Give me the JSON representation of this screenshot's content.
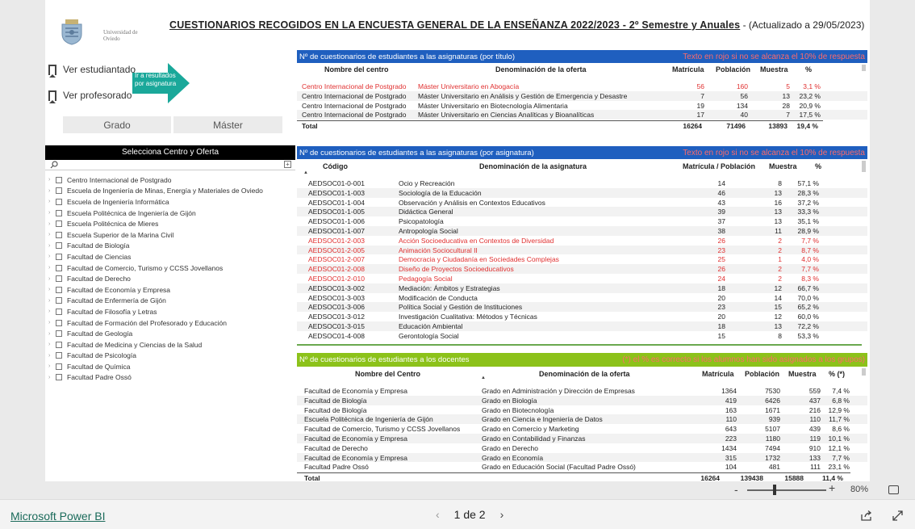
{
  "header": {
    "title": "CUESTIONARIOS RECOGIDOS EN LA ENCUESTA GENERAL DE LA ENSEÑANZA 2022/2023 - 2º Semestre y Anuales",
    "updated": " - (Actualizado a 29/05/2023)",
    "logo_text": "Universidad de Oviedo"
  },
  "left": {
    "ver_estudiantado": "Ver estudiantado",
    "ver_profesorado": "Ver profesorado",
    "arrow_btn": "Ir a resultados por asignatura",
    "grado": "Grado",
    "master": "Máster",
    "filter_title": "Selecciona Centro y Oferta",
    "centros": [
      "Centro Internacional de Postgrado",
      "Escuela de Ingeniería de Minas, Energía y Materiales de Oviedo",
      "Escuela de Ingeniería Informática",
      "Escuela Politécnica de Ingeniería de Gijón",
      "Escuela Politécnica de Mieres",
      "Escuela Superior de la Marina Civil",
      "Facultad de Biología",
      "Facultad de Ciencias",
      "Facultad de Comercio, Turismo y CCSS Jovellanos",
      "Facultad de Derecho",
      "Facultad de Economía y Empresa",
      "Facultad de Enfermería de Gijón",
      "Facultad de Filosofía y Letras",
      "Facultad de Formación del Profesorado y Educación",
      "Facultad de Geología",
      "Facultad de Medicina y Ciencias de la Salud",
      "Facultad de Psicología",
      "Facultad de Química",
      "Facultad Padre Ossó"
    ]
  },
  "t1": {
    "title": "Nº de cuestionarios de estudiantes a las asignaturas (por título)",
    "note": "Texto en rojo si no se alcanza el 10% de respuesta",
    "cols": [
      "Nombre del centro",
      "Denominación de la oferta",
      "Matrícula",
      "Población",
      "Muestra",
      "%"
    ],
    "rows": [
      {
        "c": "Centro Internacional de Postgrado",
        "o": "Máster Universitario en Abogacía",
        "m": "56",
        "p": "160",
        "mu": "5",
        "pc": "3,1 %",
        "red": true
      },
      {
        "c": "Centro Internacional de Postgrado",
        "o": "Máster Universitario en Análisis y Gestión de Emergencia y Desastre",
        "m": "7",
        "p": "56",
        "mu": "13",
        "pc": "23,2 %"
      },
      {
        "c": "Centro Internacional de Postgrado",
        "o": "Máster Universitario en Biotecnología Alimentaria",
        "m": "19",
        "p": "134",
        "mu": "28",
        "pc": "20,9 %"
      },
      {
        "c": "Centro Internacional de Postgrado",
        "o": "Máster Universitario en Ciencias Analíticas y Bioanalíticas",
        "m": "17",
        "p": "40",
        "mu": "7",
        "pc": "17,5 %"
      }
    ],
    "total": {
      "label": "Total",
      "m": "16264",
      "p": "71496",
      "mu": "13893",
      "pc": "19,4 %"
    }
  },
  "t2": {
    "title": "Nº de cuestionarios de estudiantes a las asignaturas (por asignatura)",
    "note": "Texto en rojo si no se alcanza el 10% de respuesta",
    "cols": [
      "Código",
      "Denominación de la asignatura",
      "Matrícula / Población",
      "Muestra",
      "%"
    ],
    "rows": [
      {
        "c": "AEDSOC01-0-001",
        "n": "Ocio y Recreación",
        "m": "14",
        "mu": "8",
        "pc": "57,1 %"
      },
      {
        "c": "AEDSOC01-1-003",
        "n": "Sociología de la Educación",
        "m": "46",
        "mu": "13",
        "pc": "28,3 %"
      },
      {
        "c": "AEDSOC01-1-004",
        "n": "Observación y Análisis en Contextos Educativos",
        "m": "43",
        "mu": "16",
        "pc": "37,2 %"
      },
      {
        "c": "AEDSOC01-1-005",
        "n": "Didáctica General",
        "m": "39",
        "mu": "13",
        "pc": "33,3 %"
      },
      {
        "c": "AEDSOC01-1-006",
        "n": "Psicopatología",
        "m": "37",
        "mu": "13",
        "pc": "35,1 %"
      },
      {
        "c": "AEDSOC01-1-007",
        "n": "Antropología Social",
        "m": "38",
        "mu": "11",
        "pc": "28,9 %"
      },
      {
        "c": "AEDSOC01-2-003",
        "n": "Acción Socioeducativa en Contextos de Diversidad",
        "m": "26",
        "mu": "2",
        "pc": "7,7 %",
        "red": true
      },
      {
        "c": "AEDSOC01-2-005",
        "n": "Animación Sociocultural II",
        "m": "23",
        "mu": "2",
        "pc": "8,7 %",
        "red": true
      },
      {
        "c": "AEDSOC01-2-007",
        "n": "Democracia y Ciudadanía en Sociedades Complejas",
        "m": "25",
        "mu": "1",
        "pc": "4,0 %",
        "red": true
      },
      {
        "c": "AEDSOC01-2-008",
        "n": "Diseño de Proyectos Socioeducativos",
        "m": "26",
        "mu": "2",
        "pc": "7,7 %",
        "red": true
      },
      {
        "c": "AEDSOC01-2-010",
        "n": "Pedagogía Social",
        "m": "24",
        "mu": "2",
        "pc": "8,3 %",
        "red": true
      },
      {
        "c": "AEDSOC01-3-002",
        "n": "Mediación: Ámbitos y Estrategias",
        "m": "18",
        "mu": "12",
        "pc": "66,7 %"
      },
      {
        "c": "AEDSOC01-3-003",
        "n": "Modificación de Conducta",
        "m": "20",
        "mu": "14",
        "pc": "70,0 %"
      },
      {
        "c": "AEDSOC01-3-006",
        "n": "Política Social y Gestión de Instituciones",
        "m": "23",
        "mu": "15",
        "pc": "65,2 %"
      },
      {
        "c": "AEDSOC01-3-012",
        "n": "Investigación Cualitativa: Métodos y Técnicas",
        "m": "20",
        "mu": "12",
        "pc": "60,0 %"
      },
      {
        "c": "AEDSOC01-3-015",
        "n": "Educación Ambiental",
        "m": "18",
        "mu": "13",
        "pc": "72,2 %"
      },
      {
        "c": "AEDSOC01-4-008",
        "n": "Gerontología Social",
        "m": "15",
        "mu": "8",
        "pc": "53,3 %"
      }
    ]
  },
  "t3": {
    "title": "Nº de cuestionarios de estudiantes a los docentes",
    "note": "(*) el % es correcto si los alumnos han sido asignados a los grupos)",
    "cols": [
      "Nombre del Centro",
      "Denominación de la oferta",
      "Matrícula",
      "Población",
      "Muestra",
      "% (*)"
    ],
    "rows": [
      {
        "c": "Facultad de Economía y Empresa",
        "o": "Grado en Administración y Dirección de Empresas",
        "m": "1364",
        "p": "7530",
        "mu": "559",
        "pc": "7,4 %"
      },
      {
        "c": "Facultad de Biología",
        "o": "Grado en Biología",
        "m": "419",
        "p": "6426",
        "mu": "437",
        "pc": "6,8 %"
      },
      {
        "c": "Facultad de Biología",
        "o": "Grado en Biotecnología",
        "m": "163",
        "p": "1671",
        "mu": "216",
        "pc": "12,9 %"
      },
      {
        "c": "Escuela Politécnica de Ingeniería de Gijón",
        "o": "Grado en Ciencia e Ingeniería de Datos",
        "m": "110",
        "p": "939",
        "mu": "110",
        "pc": "11,7 %"
      },
      {
        "c": "Facultad de Comercio, Turismo y CCSS Jovellanos",
        "o": "Grado en Comercio y Marketing",
        "m": "643",
        "p": "5107",
        "mu": "439",
        "pc": "8,6 %"
      },
      {
        "c": "Facultad de Economía y Empresa",
        "o": "Grado en Contabilidad y Finanzas",
        "m": "223",
        "p": "1180",
        "mu": "119",
        "pc": "10,1 %"
      },
      {
        "c": "Facultad de Derecho",
        "o": "Grado en Derecho",
        "m": "1434",
        "p": "7494",
        "mu": "910",
        "pc": "12,1 %"
      },
      {
        "c": "Facultad de Economía y Empresa",
        "o": "Grado en Economía",
        "m": "315",
        "p": "1732",
        "mu": "133",
        "pc": "7,7 %"
      },
      {
        "c": "Facultad Padre Ossó",
        "o": "Grado en Educación Social (Facultad Padre Ossó)",
        "m": "104",
        "p": "481",
        "mu": "111",
        "pc": "23,1 %"
      }
    ],
    "total": {
      "label": "Total",
      "m": "16264",
      "p": "139438",
      "mu": "15888",
      "pc": "11,4 %"
    }
  },
  "footer": {
    "brand": "Microsoft Power BI",
    "page": "1 de 2",
    "zoom": "80%"
  },
  "colors": {
    "blue": "#1f5fbf",
    "green": "#8cc21a",
    "red": "#e03030"
  }
}
